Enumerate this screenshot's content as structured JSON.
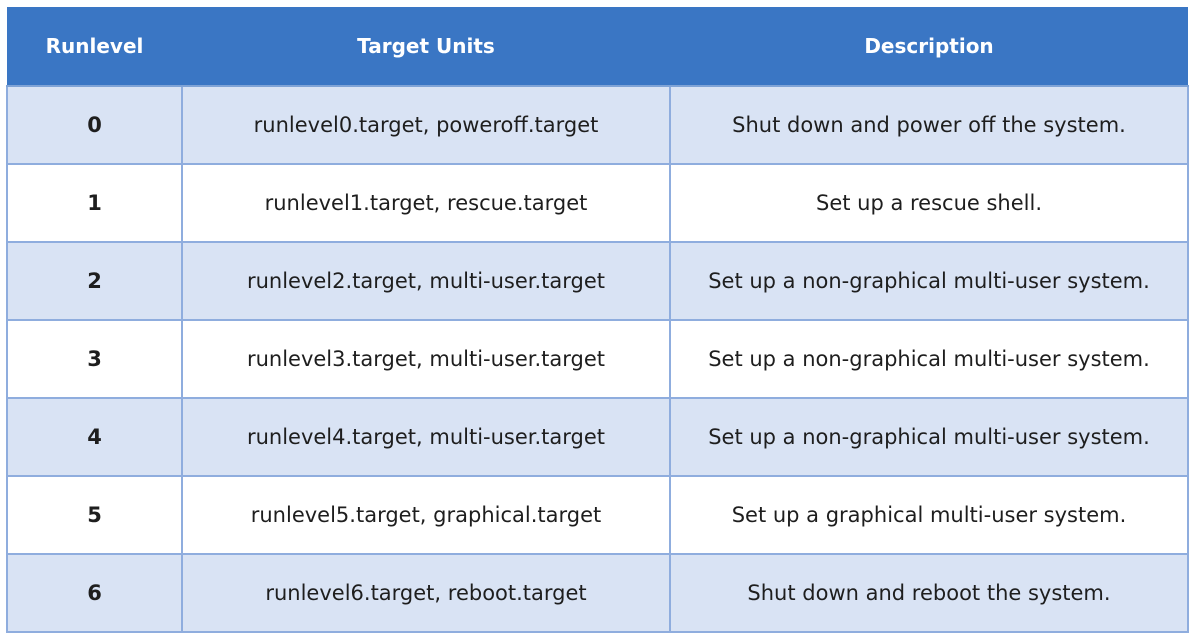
{
  "table": {
    "headers": [
      "Runlevel",
      "Target Units",
      "Description"
    ],
    "rows": [
      {
        "runlevel": "0",
        "targets": "runlevel0.target, poweroff.target",
        "description": "Shut down and power off the system."
      },
      {
        "runlevel": "1",
        "targets": "runlevel1.target, rescue.target",
        "description": "Set up a rescue shell."
      },
      {
        "runlevel": "2",
        "targets": "runlevel2.target, multi-user.target",
        "description": "Set up a non-graphical multi-user system."
      },
      {
        "runlevel": "3",
        "targets": "runlevel3.target, multi-user.target",
        "description": "Set up a non-graphical multi-user system."
      },
      {
        "runlevel": "4",
        "targets": "runlevel4.target, multi-user.target",
        "description": "Set up a non-graphical multi-user system."
      },
      {
        "runlevel": "5",
        "targets": "runlevel5.target, graphical.target",
        "description": "Set up a graphical multi-user system."
      },
      {
        "runlevel": "6",
        "targets": "runlevel6.target, reboot.target",
        "description": "Shut down and reboot the system."
      }
    ]
  },
  "colors": {
    "header_bg": "#3a76c4",
    "row_alt_bg": "#d9e3f4",
    "border": "#8fadde"
  }
}
